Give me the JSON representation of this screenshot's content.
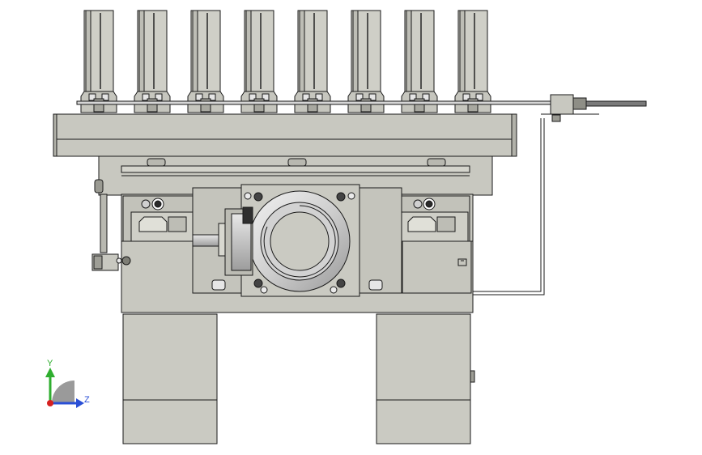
{
  "viewport": {
    "background": "#ffffff",
    "part_fill": "#c8c8c0",
    "part_fill_dark": "#a9a9a1",
    "part_fill_light": "#dcdcd4",
    "edge_color": "#1a1a1a",
    "metal_fill": "#d8d8d8"
  },
  "triad": {
    "y_label": "Y",
    "z_label": "Z",
    "y_color": "#2fae2f",
    "z_color": "#2a4fd6",
    "x_color": "#d62020"
  },
  "gripper_fingers": {
    "count": 8
  },
  "icons": [
    "coordinate-triad-icon"
  ]
}
